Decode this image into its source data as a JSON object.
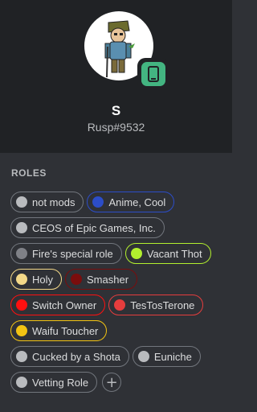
{
  "user": {
    "display_name": "S",
    "tag": "Rusp#9532",
    "status": "mobile-online",
    "status_color": "#43b581",
    "avatar_icon": "cartoon-soldier-avatar"
  },
  "roles_section": {
    "title": "ROLES",
    "roles": [
      {
        "name": "not mods",
        "color": "#b9bbbe"
      },
      {
        "name": "Anime, Cool",
        "color": "#2c4dc8"
      },
      {
        "name": "CEOS of Epic Games, Inc.",
        "color": "#b9bbbe"
      },
      {
        "name": "Fire's special role",
        "color": "#7f8187"
      },
      {
        "name": "Vacant Thot",
        "color": "#b2ef2e"
      },
      {
        "name": "Holy",
        "color": "#f3d888"
      },
      {
        "name": "Smasher",
        "color": "#7a0d0d"
      },
      {
        "name": "Switch Owner",
        "color": "#ff1010"
      },
      {
        "name": "TesTosTerone",
        "color": "#e53d3d"
      },
      {
        "name": "Waifu Toucher",
        "color": "#f2c313"
      },
      {
        "name": "Cucked by a Shota",
        "color": "#b9bbbe"
      },
      {
        "name": "Euniche",
        "color": "#b9bbbe"
      },
      {
        "name": "Vetting Role",
        "color": "#b9bbbe"
      }
    ],
    "add_icon": "plus-icon"
  }
}
